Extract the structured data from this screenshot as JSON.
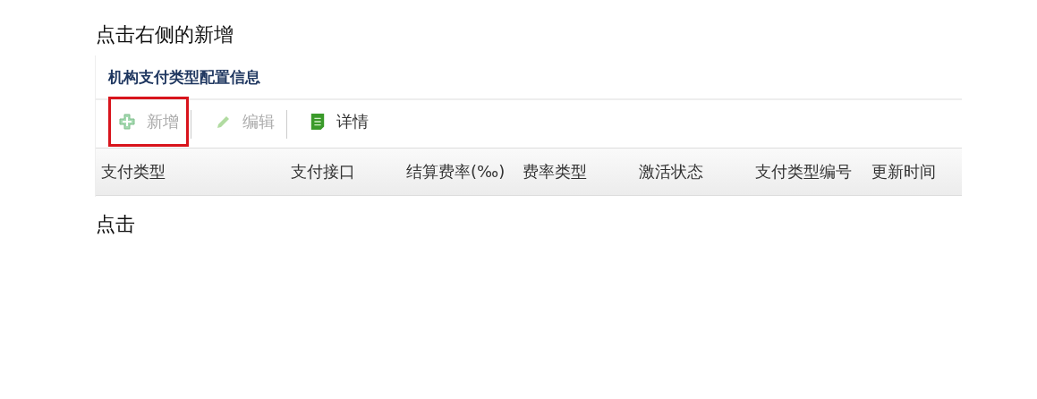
{
  "paragraphs_before": [
    "点击右侧的新增"
  ],
  "panel": {
    "title": "机构支付类型配置信息",
    "toolbar": [
      {
        "kind": "add",
        "label": "新增",
        "disabled": true,
        "highlighted": true
      },
      {
        "kind": "edit",
        "label": "编辑",
        "disabled": true,
        "highlighted": false
      },
      {
        "kind": "detail",
        "label": "详情",
        "disabled": false,
        "highlighted": false
      }
    ],
    "table": {
      "columns": [
        "支付类型",
        "支付接口",
        "结算费率(‰)",
        "费率类型",
        "激活状态",
        "支付类型编号",
        "更新时间"
      ]
    }
  },
  "paragraphs_after": [
    "点击"
  ]
}
